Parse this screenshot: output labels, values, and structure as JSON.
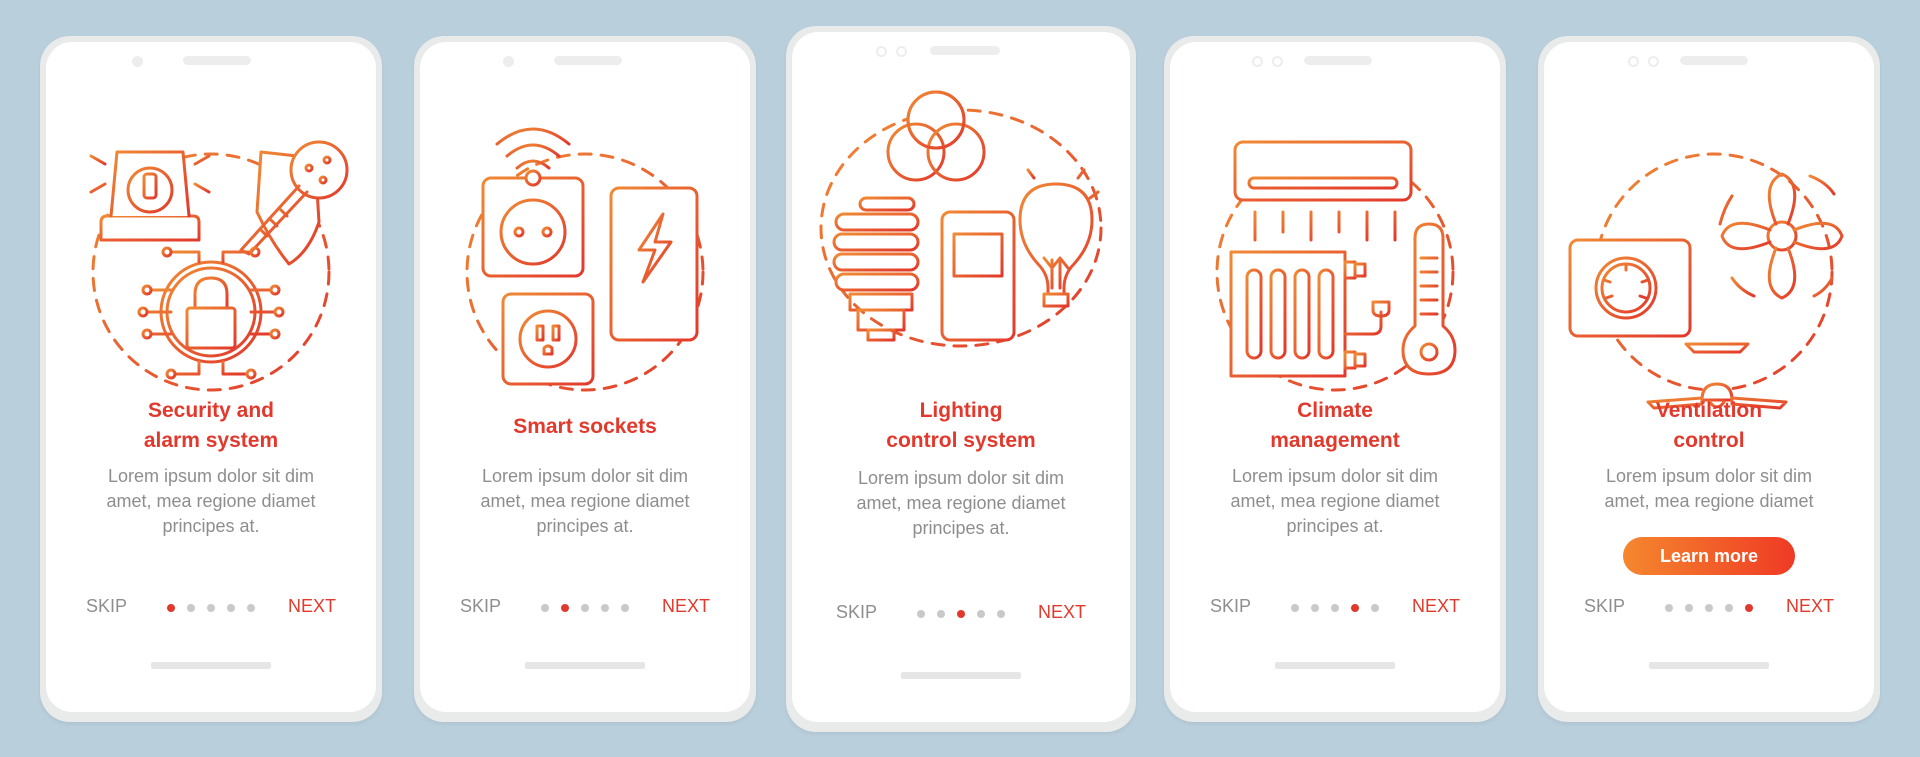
{
  "colors": {
    "background": "#b9cfdb",
    "accent": "#e2392c",
    "gradient_start": "#f5872e",
    "gradient_end": "#ef3a25",
    "text_muted": "#8e8e8e",
    "dot_inactive": "#c9c9c9"
  },
  "screens": [
    {
      "icon": "security-alarm-illustration",
      "title_line1": "Security and",
      "title_line2": "alarm system",
      "desc_line1": "Lorem ipsum dolor sit dim",
      "desc_line2": "amet, mea regione diamet",
      "desc_line3": "principes at.",
      "skip": "SKIP",
      "next": "NEXT",
      "active_page": 1,
      "total_pages": 5
    },
    {
      "icon": "smart-sockets-illustration",
      "title_line1": "Smart sockets",
      "desc_line1": "Lorem ipsum dolor sit dim",
      "desc_line2": "amet, mea regione diamet",
      "desc_line3": "principes at.",
      "skip": "SKIP",
      "next": "NEXT",
      "active_page": 2,
      "total_pages": 5
    },
    {
      "icon": "lighting-control-illustration",
      "title_line1": "Lighting",
      "title_line2": "control system",
      "desc_line1": "Lorem ipsum dolor sit dim",
      "desc_line2": "amet, mea regione diamet",
      "desc_line3": "principes at.",
      "skip": "SKIP",
      "next": "NEXT",
      "active_page": 3,
      "total_pages": 5
    },
    {
      "icon": "climate-management-illustration",
      "title_line1": "Climate",
      "title_line2": "management",
      "desc_line1": "Lorem ipsum dolor sit dim",
      "desc_line2": "amet, mea regione diamet",
      "desc_line3": "principes at.",
      "skip": "SKIP",
      "next": "NEXT",
      "active_page": 4,
      "total_pages": 5
    },
    {
      "icon": "ventilation-control-illustration",
      "title_line1": "Ventilation",
      "title_line2": "control",
      "desc_line1": "Lorem ipsum dolor sit dim",
      "desc_line2": "amet, mea regione diamet",
      "cta": "Learn more",
      "skip": "SKIP",
      "next": "NEXT",
      "active_page": 5,
      "total_pages": 5
    }
  ]
}
